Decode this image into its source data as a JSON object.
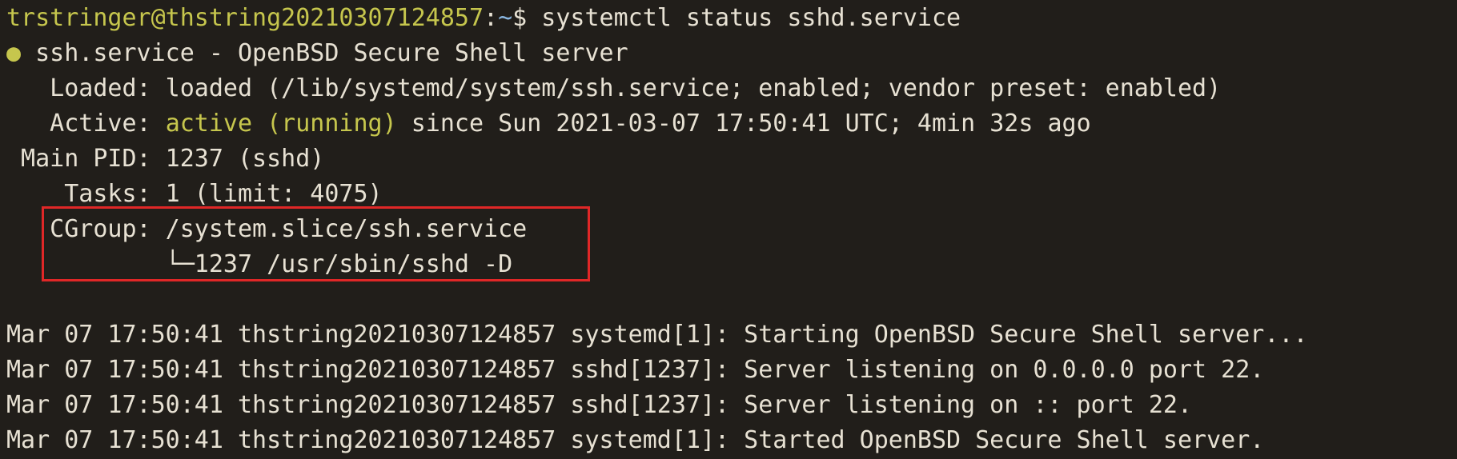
{
  "prompt": {
    "user_host": "trstringer@thstring20210307124857",
    "separator": ":",
    "cwd": "~",
    "symbol": "$",
    "command": " systemctl status sshd.service"
  },
  "status": {
    "bullet": "●",
    "unit_line": " ssh.service - OpenBSD Secure Shell server",
    "loaded": "   Loaded: loaded (/lib/systemd/system/ssh.service; enabled; vendor preset: enabled)",
    "active_label": "   Active: ",
    "active_state": "active (running)",
    "active_since": " since Sun 2021-03-07 17:50:41 UTC; 4min 32s ago",
    "main_pid": " Main PID: 1237 (sshd)",
    "tasks": "    Tasks: 1 (limit: 4075)",
    "cgroup": "   CGroup: /system.slice/ssh.service",
    "cgroup_child": "           └─1237 /usr/sbin/sshd -D"
  },
  "logs": [
    "Mar 07 17:50:41 thstring20210307124857 systemd[1]: Starting OpenBSD Secure Shell server...",
    "Mar 07 17:50:41 thstring20210307124857 sshd[1237]: Server listening on 0.0.0.0 port 22.",
    "Mar 07 17:50:41 thstring20210307124857 sshd[1237]: Server listening on :: port 22.",
    "Mar 07 17:50:41 thstring20210307124857 systemd[1]: Started OpenBSD Secure Shell server."
  ],
  "colors": {
    "background": "#211e1a",
    "foreground": "#e7e1d3",
    "accent_green": "#c6c64d",
    "path_blue": "#8ab6e0",
    "highlight_red": "#e02727"
  }
}
